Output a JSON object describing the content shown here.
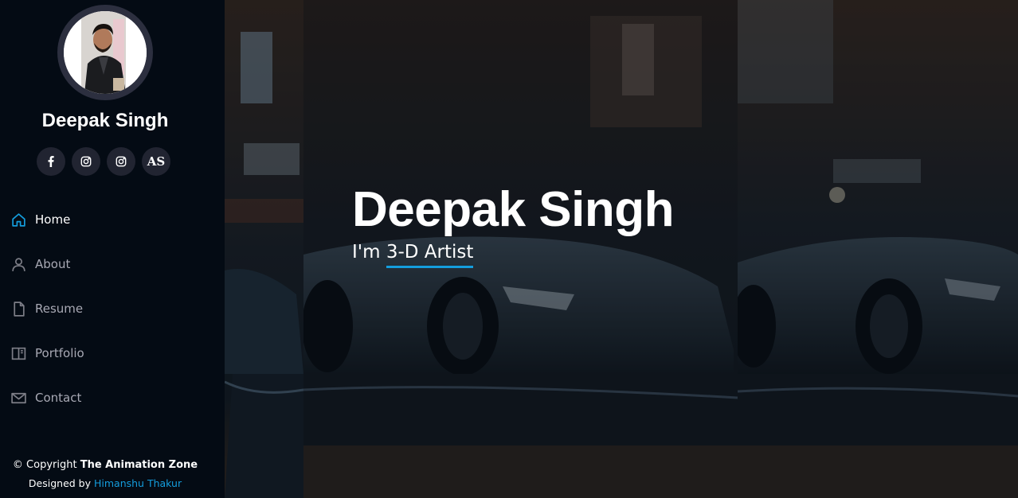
{
  "profile": {
    "name": "Deepak Singh"
  },
  "social": [
    {
      "icon": "facebook-icon"
    },
    {
      "icon": "instagram-icon"
    },
    {
      "icon": "instagram-icon"
    },
    {
      "icon": "artstation-icon",
      "text": "AS"
    }
  ],
  "nav": {
    "items": [
      {
        "label": "Home",
        "icon": "home-icon",
        "active": true
      },
      {
        "label": "About",
        "icon": "person-icon",
        "active": false
      },
      {
        "label": "Resume",
        "icon": "file-icon",
        "active": false
      },
      {
        "label": "Portfolio",
        "icon": "book-icon",
        "active": false
      },
      {
        "label": "Contact",
        "icon": "envelope-icon",
        "active": false
      }
    ]
  },
  "footer": {
    "copyright_prefix": "© Copyright",
    "copyright_name": "The Animation Zone",
    "designed_prefix": "Designed by",
    "designer": "Himanshu Thakur"
  },
  "hero": {
    "title": "Deepak Singh",
    "subtitle_prefix": "I'm",
    "subtitle_typed": "3-D Artist"
  },
  "colors": {
    "accent": "#149ddd",
    "sidebar_bg": "#040b14",
    "nav_text": "#a8a9b4"
  }
}
